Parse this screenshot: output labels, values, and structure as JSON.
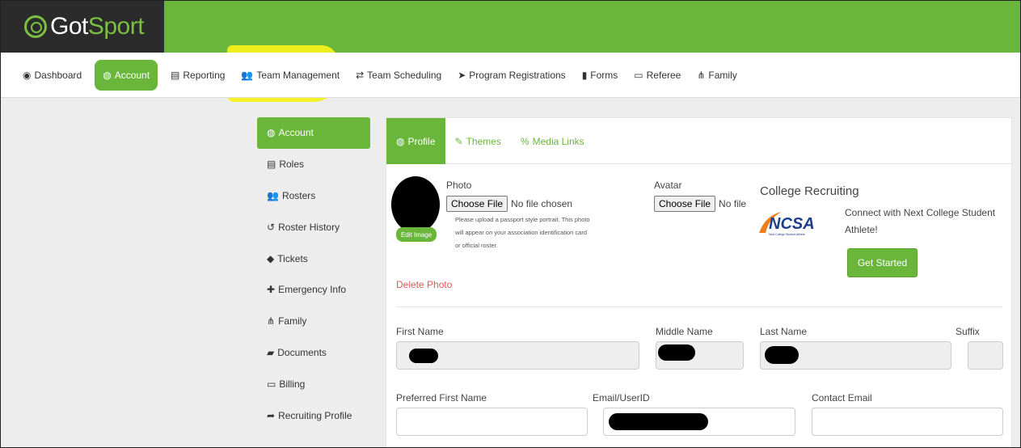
{
  "brand": {
    "name_dark": "Got",
    "name_accent": "Sport"
  },
  "nav": [
    {
      "label": "Dashboard",
      "icon": "dashboard-icon",
      "glyph": "◉"
    },
    {
      "label": "Account",
      "icon": "user-circle-icon",
      "glyph": "◍"
    },
    {
      "label": "Reporting",
      "icon": "report-icon",
      "glyph": "▤"
    },
    {
      "label": "Team Management",
      "icon": "users-icon",
      "glyph": "👥"
    },
    {
      "label": "Team Scheduling",
      "icon": "exchange-icon",
      "glyph": "⇄"
    },
    {
      "label": "Program Registrations",
      "icon": "send-icon",
      "glyph": "➤"
    },
    {
      "label": "Forms",
      "icon": "file-icon",
      "glyph": "▮"
    },
    {
      "label": "Referee",
      "icon": "calendar-icon",
      "glyph": "▭"
    },
    {
      "label": "Family",
      "icon": "sitemap-icon",
      "glyph": "⋔"
    }
  ],
  "subnav": [
    {
      "label": "Account",
      "glyph": "◍"
    },
    {
      "label": "Roles",
      "glyph": "▤"
    },
    {
      "label": "Rosters",
      "glyph": "👥"
    },
    {
      "label": "Roster History",
      "glyph": "↺"
    },
    {
      "label": "Tickets",
      "glyph": "◆"
    },
    {
      "label": "Emergency Info",
      "glyph": "✚"
    },
    {
      "label": "Family",
      "glyph": "⋔"
    },
    {
      "label": "Documents",
      "glyph": "▰"
    },
    {
      "label": "Billing",
      "glyph": "▭"
    },
    {
      "label": "Recruiting Profile",
      "glyph": "➦"
    }
  ],
  "tabs": [
    {
      "label": "Profile",
      "glyph": "◍"
    },
    {
      "label": "Themes",
      "glyph": "✎"
    },
    {
      "label": "Media Links",
      "glyph": "%"
    }
  ],
  "profile": {
    "photo_label": "Photo",
    "choose_file": "Choose File",
    "no_file": "No file chosen",
    "hint": "Please upload a passport style portrait. This photo will appear on your association identification card or official roster.",
    "edit_image": "Edit Image",
    "delete_photo": "Delete Photo",
    "avatar_label": "Avatar",
    "avatar_no_file": "No file"
  },
  "recruiting": {
    "title": "College Recruiting",
    "logo_text": "NCSA",
    "logo_sub": "Next College Student Athlete",
    "description": "Connect with Next College Student Athlete!",
    "cta": "Get Started"
  },
  "form": {
    "first_name": "First Name",
    "middle_name": "Middle Name",
    "last_name": "Last Name",
    "suffix": "Suffix",
    "preferred_first_name": "Preferred First Name",
    "email_userid": "Email/UserID",
    "contact_email": "Contact Email"
  }
}
